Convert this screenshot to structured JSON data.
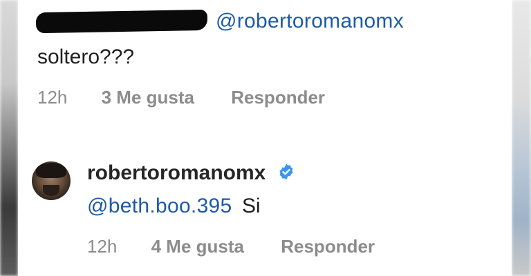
{
  "comments": [
    {
      "author_redacted": true,
      "mention": "@robertoromanomx",
      "text": "soltero???",
      "time": "12h",
      "likes": "3 Me gusta",
      "reply": "Responder"
    },
    {
      "author": "robertoromanomx",
      "verified": true,
      "mention": "@beth.boo.395",
      "text": "Si",
      "time": "12h",
      "likes": "4 Me gusta",
      "reply": "Responder"
    }
  ],
  "colors": {
    "mention": "#1e5aa8",
    "meta": "#8c8c8c",
    "verified": "#3897f0"
  },
  "icons": {
    "verified": "verified-badge-icon",
    "avatar": "profile-avatar"
  }
}
